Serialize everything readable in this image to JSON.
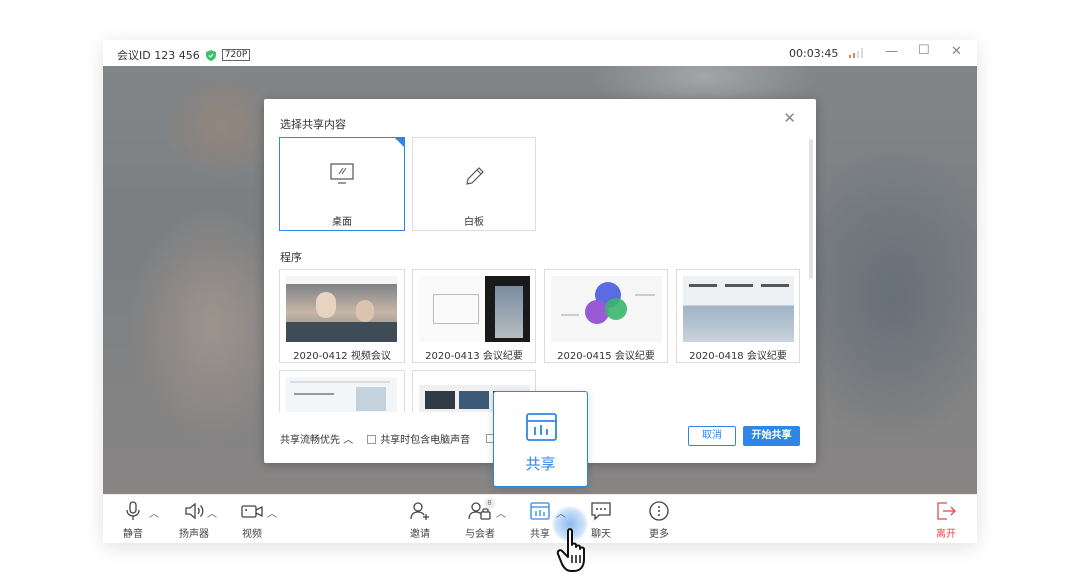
{
  "titlebar": {
    "meeting_id": "会议ID 123 456",
    "resolution": "720P",
    "timer": "00:03:45"
  },
  "dialog": {
    "title": "选择共享内容",
    "cards": [
      {
        "label": "桌面",
        "selected": true
      },
      {
        "label": "白板",
        "selected": false
      }
    ],
    "programs_title": "程序",
    "programs": [
      {
        "label": "2020-0412 视频会议"
      },
      {
        "label": "2020-0413 会议纪要"
      },
      {
        "label": "2020-0415 会议纪要"
      },
      {
        "label": "2020-0418 会议纪要"
      }
    ],
    "fluency_label": "共享流畅优先",
    "audio_label": "共享时包含电脑声音",
    "cancel": "取消",
    "start": "开始共享"
  },
  "share_popup": {
    "label": "共享"
  },
  "toolbar": {
    "mute": "静音",
    "speaker": "扬声器",
    "video": "视频",
    "invite": "邀请",
    "participants": "与会者",
    "participants_count": "8",
    "share": "共享",
    "chat": "聊天",
    "more": "更多",
    "leave": "离开"
  },
  "colors": {
    "accent": "#2e86e6",
    "leave": "#e5484d"
  }
}
